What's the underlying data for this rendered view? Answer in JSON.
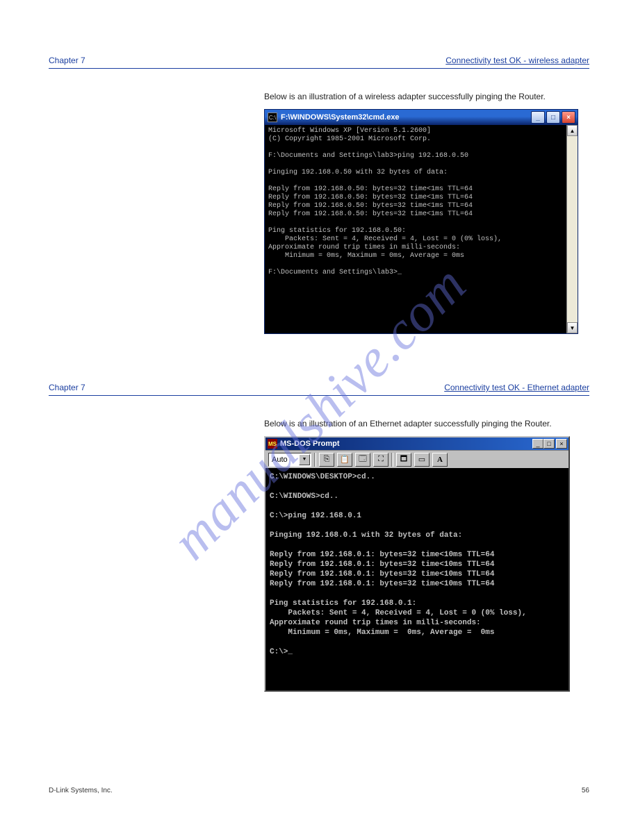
{
  "header1": {
    "chapter_ref": "Chapter 7",
    "section": "Connectivity test OK - wireless adapter"
  },
  "header2": {
    "chapter_ref": "Chapter 7",
    "section": "Connectivity test OK - Ethernet adapter"
  },
  "body1": "Below is an illustration of a wireless adapter successfully pinging the Router.",
  "body2": "Below is an illustration of an Ethernet adapter successfully pinging the Router.",
  "xp_window": {
    "title": "F:\\WINDOWS\\System32\\cmd.exe",
    "icon_label": "C:\\",
    "btn_min": "_",
    "btn_max": "□",
    "btn_close": "×",
    "sb_up": "▲",
    "sb_down": "▼",
    "console": "Microsoft Windows XP [Version 5.1.2600]\n(C) Copyright 1985-2001 Microsoft Corp.\n\nF:\\Documents and Settings\\lab3>ping 192.168.0.50\n\nPinging 192.168.0.50 with 32 bytes of data:\n\nReply from 192.168.0.50: bytes=32 time<1ms TTL=64\nReply from 192.168.0.50: bytes=32 time<1ms TTL=64\nReply from 192.168.0.50: bytes=32 time<1ms TTL=64\nReply from 192.168.0.50: bytes=32 time<1ms TTL=64\n\nPing statistics for 192.168.0.50:\n    Packets: Sent = 4, Received = 4, Lost = 0 (0% loss),\nApproximate round trip times in milli-seconds:\n    Minimum = 0ms, Maximum = 0ms, Average = 0ms\n\nF:\\Documents and Settings\\lab3>_"
  },
  "nx_window": {
    "title": "MS-DOS Prompt",
    "icon_label": "MS",
    "btn_min": "_",
    "btn_max": "□",
    "btn_close": "×",
    "select_value": "Auto",
    "tb_copy": "⎘",
    "tb_paste": "📋",
    "tb_props": "🗔",
    "tb_full": "⛶",
    "tb_bg": "🗖",
    "tb_mark": "▭",
    "tb_font": "A",
    "console": "C:\\WINDOWS\\DESKTOP>cd..\n\nC:\\WINDOWS>cd..\n\nC:\\>ping 192.168.0.1\n\nPinging 192.168.0.1 with 32 bytes of data:\n\nReply from 192.168.0.1: bytes=32 time<10ms TTL=64\nReply from 192.168.0.1: bytes=32 time<10ms TTL=64\nReply from 192.168.0.1: bytes=32 time<10ms TTL=64\nReply from 192.168.0.1: bytes=32 time<10ms TTL=64\n\nPing statistics for 192.168.0.1:\n    Packets: Sent = 4, Received = 4, Lost = 0 (0% loss),\nApproximate round trip times in milli-seconds:\n    Minimum = 0ms, Maximum =  0ms, Average =  0ms\n\nC:\\>_"
  },
  "footer": {
    "left": "D-Link Systems, Inc.",
    "right": "56"
  },
  "watermark": "manualshive.com"
}
